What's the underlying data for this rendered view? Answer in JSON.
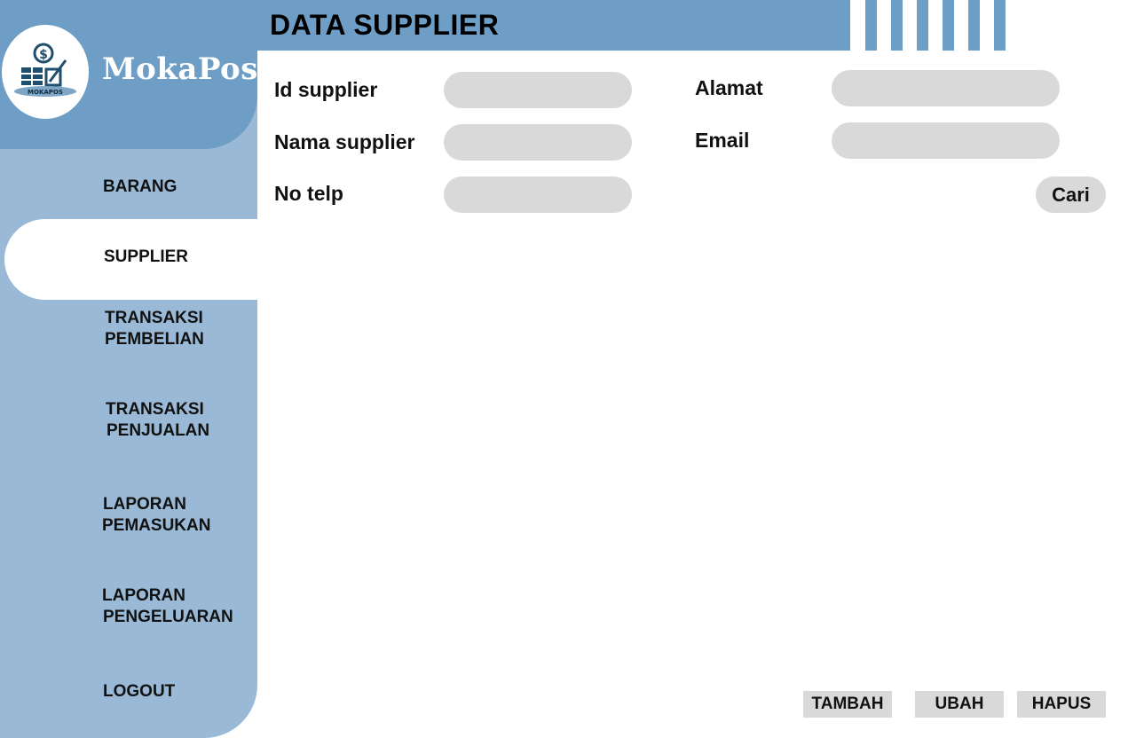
{
  "brand": {
    "name": "MokaPos",
    "logo_text": "MOKAPOS"
  },
  "sidebar": {
    "items": [
      {
        "lines": [
          "BARANG"
        ]
      },
      {
        "lines": [
          "SUPPLIER"
        ],
        "active": true
      },
      {
        "lines": [
          "TRANSAKSI",
          "PEMBELIAN"
        ]
      },
      {
        "lines": [
          "TRANSAKSI",
          "PENJUALAN"
        ]
      },
      {
        "lines": [
          "LAPORAN",
          "PEMASUKAN"
        ]
      },
      {
        "lines": [
          "LAPORAN",
          "PENGELUARAN"
        ]
      },
      {
        "lines": [
          "LOGOUT"
        ]
      }
    ]
  },
  "header": {
    "title": "DATA SUPPLIER"
  },
  "form": {
    "id_label": "Id supplier",
    "id_value": "",
    "nama_label": "Nama supplier",
    "nama_value": "",
    "telp_label": "No telp",
    "telp_value": "",
    "alamat_label": "Alamat",
    "alamat_value": "",
    "email_label": "Email",
    "email_value": "",
    "cari_label": "Cari"
  },
  "actions": {
    "tambah_label": "TAMBAH",
    "ubah_label": "UBAH",
    "hapus_label": "HAPUS"
  },
  "colors": {
    "sidebar": "#99b9d6",
    "brand_header": "#6e9ec5",
    "field": "#d9d9d9",
    "logo_accent": "#1f4e6e"
  }
}
